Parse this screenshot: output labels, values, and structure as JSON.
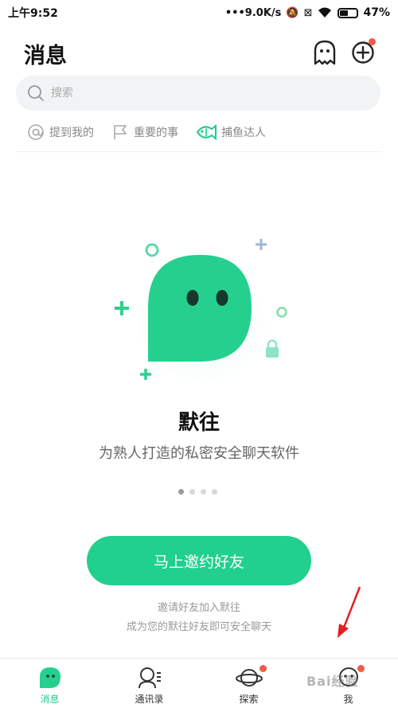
{
  "status_bar": {
    "time": "上午9:52",
    "network_speed": "•••9.0K/s",
    "battery": "47%"
  },
  "header": {
    "title": "消息"
  },
  "search": {
    "placeholder": "搜索"
  },
  "filters": [
    {
      "label": "提到我的",
      "icon": "at-icon"
    },
    {
      "label": "重要的事",
      "icon": "flag-icon"
    },
    {
      "label": "捕鱼达人",
      "icon": "fish-icon"
    }
  ],
  "empty_state": {
    "app_name": "默往",
    "tagline": "为熟人打造的私密安全聊天软件",
    "page_count": 4,
    "active_page": 1,
    "invite_button": "马上邀约好友",
    "hint_line1": "邀请好友加入默往",
    "hint_line2": "成为您的默往好友即可安全聊天"
  },
  "tabs": [
    {
      "label": "消息",
      "icon": "chat-bubble-icon",
      "active": true
    },
    {
      "label": "通讯录",
      "icon": "contacts-icon",
      "active": false
    },
    {
      "label": "探索",
      "icon": "planet-icon",
      "active": false
    },
    {
      "label": "我",
      "icon": "profile-icon",
      "active": false
    }
  ],
  "watermark": "Bai经验",
  "colors": {
    "accent": "#21d08e",
    "badge": "#f25a4a",
    "arrow": "#e02020"
  }
}
